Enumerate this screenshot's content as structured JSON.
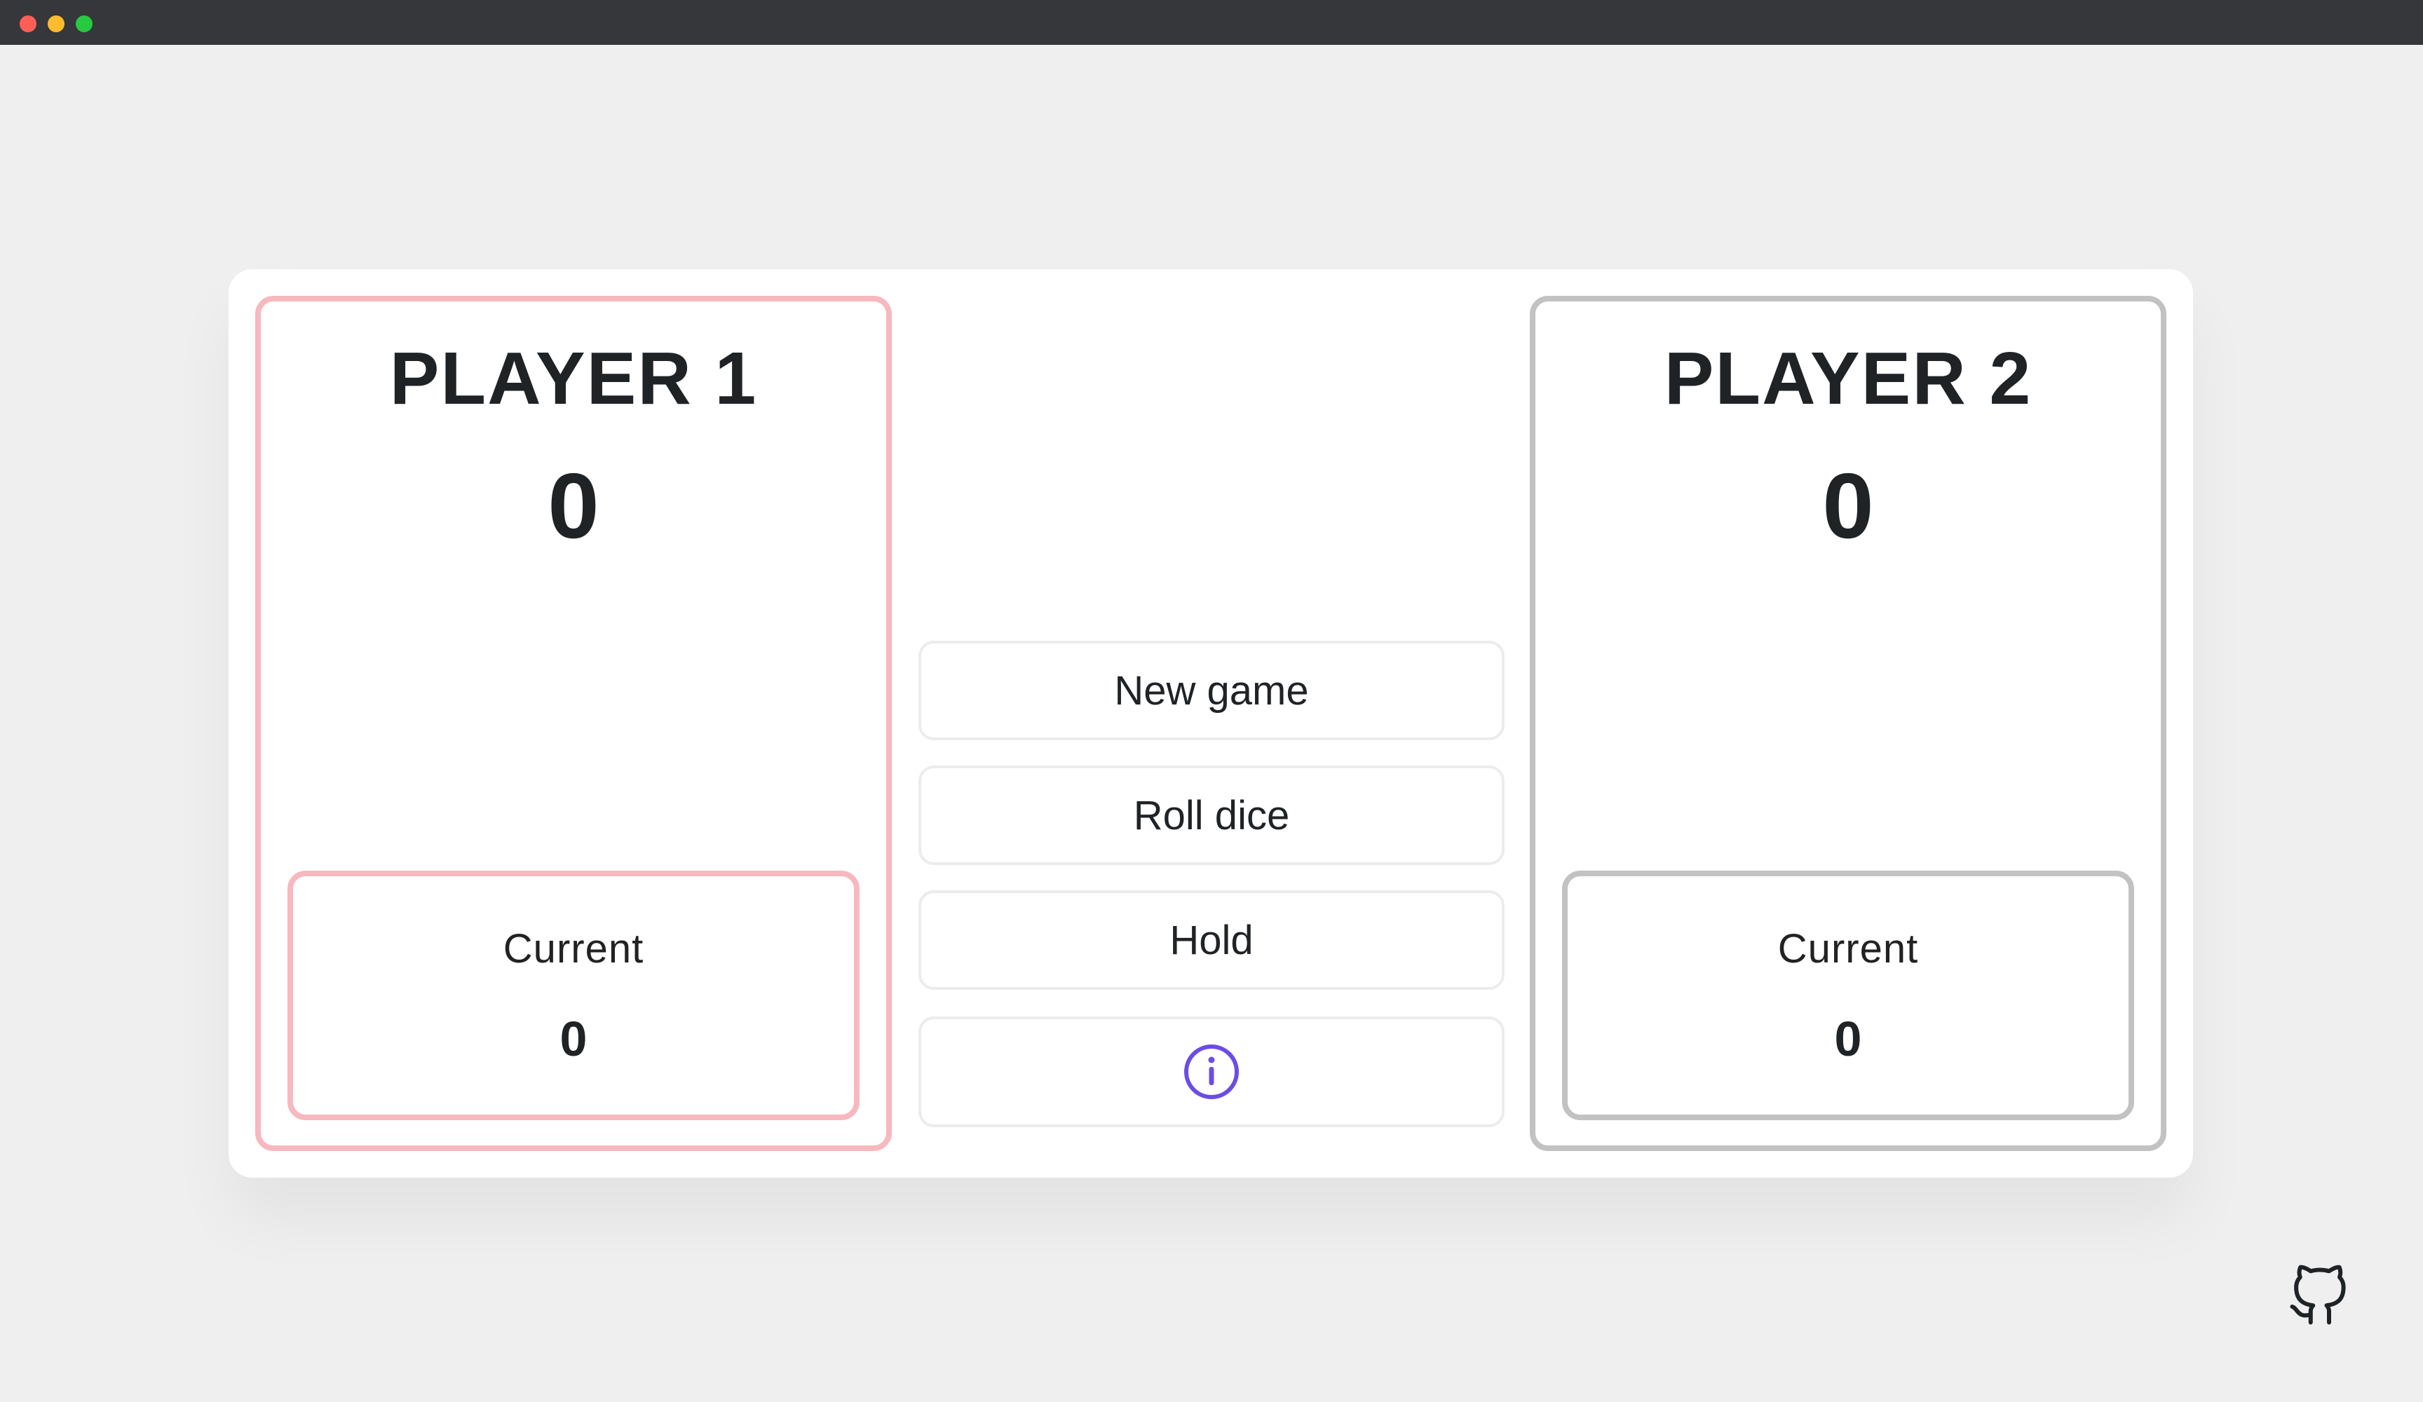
{
  "app": {
    "window_controls": [
      "close",
      "minimize",
      "maximize"
    ]
  },
  "players": [
    {
      "name": "PLAYER 1",
      "score": "0",
      "current_label": "Current",
      "current_score": "0",
      "active": true,
      "accent": "#f7b8be"
    },
    {
      "name": "PLAYER 2",
      "score": "0",
      "current_label": "Current",
      "current_score": "0",
      "active": false,
      "accent": "#c2c2c2"
    }
  ],
  "controls": {
    "new_game": "New game",
    "roll_dice": "Roll dice",
    "hold": "Hold",
    "info_icon": "info-icon"
  },
  "footer": {
    "github_icon": "github-icon"
  },
  "colors": {
    "background": "#efefef",
    "card": "#ffffff",
    "active_border": "#f7b8be",
    "inactive_border": "#c2c2c2",
    "info_accent": "#6c4ce6",
    "titlebar": "#36373a"
  }
}
